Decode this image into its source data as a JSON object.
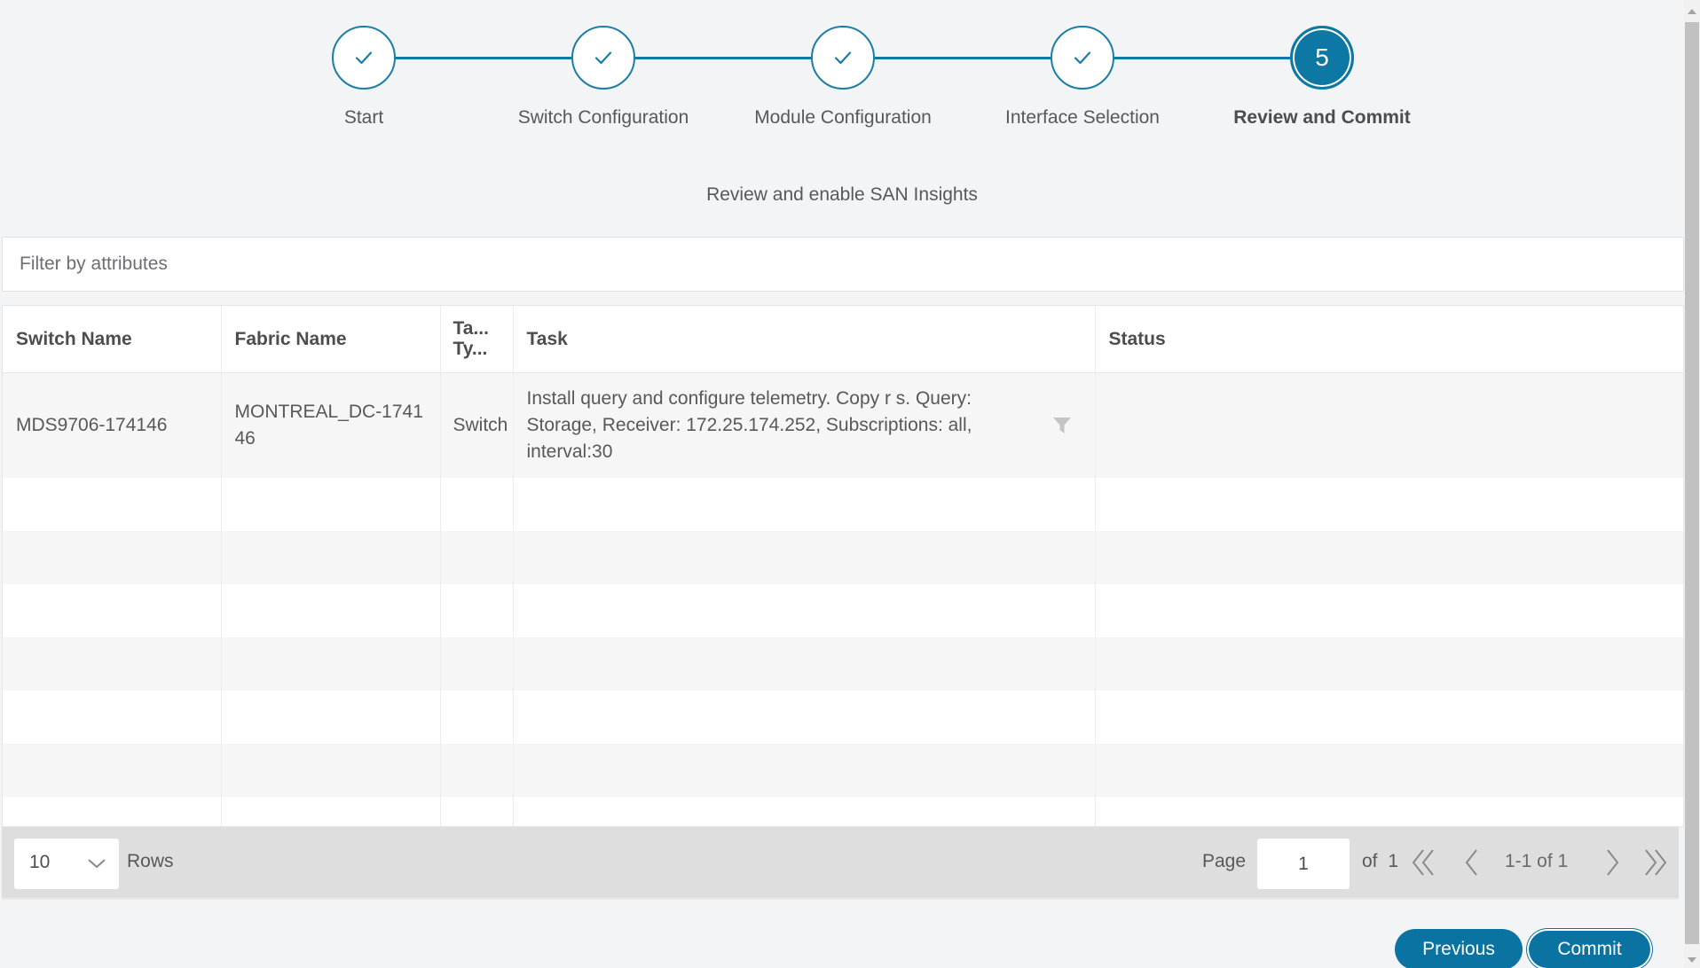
{
  "wizard": {
    "steps": [
      {
        "label": "Start",
        "state": "completed",
        "icon": "check-icon"
      },
      {
        "label": "Switch Configuration",
        "state": "completed",
        "icon": "check-icon"
      },
      {
        "label": "Module Configuration",
        "state": "completed",
        "icon": "check-icon"
      },
      {
        "label": "Interface Selection",
        "state": "completed",
        "icon": "check-icon"
      },
      {
        "label": "Review and Commit",
        "state": "active",
        "number": "5"
      }
    ],
    "accent_color": "#0d78a4"
  },
  "subtitle": "Review and enable SAN Insights",
  "filter": {
    "placeholder": "Filter by attributes",
    "value": ""
  },
  "table": {
    "columns": [
      {
        "label": "Switch Name"
      },
      {
        "label": "Fabric Name"
      },
      {
        "label": "Ta...\nTy..."
      },
      {
        "label": "Task"
      },
      {
        "label": "Status"
      }
    ],
    "rows": [
      {
        "switch_name": "MDS9706-174146",
        "fabric_name": "MONTREAL_DC-174146",
        "task_type": "Switch",
        "task": "Install query and configure telemetry. Copy r s. Query: Storage, Receiver: 172.25.174.252, Subscriptions: all, interval:30",
        "status": ""
      }
    ]
  },
  "pagination": {
    "rows_per_page": "10",
    "rows_label": "Rows",
    "page_label": "Page",
    "current_page": "1",
    "of_label": "of  1",
    "range_label": "1-1 of 1"
  },
  "footer": {
    "previous_label": "Previous",
    "commit_label": "Commit"
  }
}
